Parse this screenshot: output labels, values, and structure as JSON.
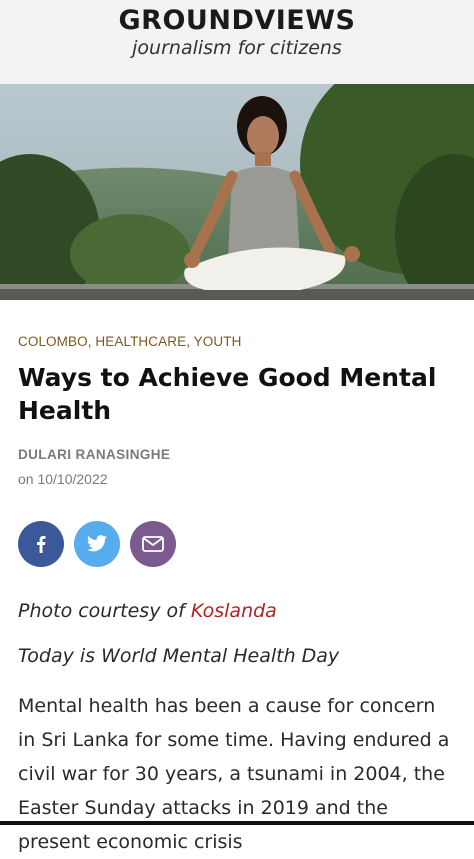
{
  "masthead": {
    "brand": "GROUNDVIEWS",
    "tagline": "journalism for citizens"
  },
  "hero": {
    "alt_icon": "meditation-photo"
  },
  "article": {
    "categories": [
      "COLOMBO",
      "HEALTHCARE",
      "YOUTH"
    ],
    "category_separator": ", ",
    "title": "Ways to Achieve Good Mental Health",
    "author": "DULARI RANASINGHE",
    "date": "on 10/10/2022",
    "credit_prefix": "Photo courtesy of ",
    "credit_link": "Koslanda",
    "intro": "Today is World Mental Health Day",
    "body": "Mental health has been a cause for concern in Sri Lanka for some time. Having endured a civil war for 30 years, a tsunami in 2004, the Easter Sunday attacks in 2019 and the present economic crisis"
  },
  "share": [
    {
      "name": "facebook",
      "icon": "facebook-icon",
      "color": "#3b5998"
    },
    {
      "name": "twitter",
      "icon": "twitter-icon",
      "color": "#55acee"
    },
    {
      "name": "email",
      "icon": "mail-icon",
      "color": "#7b5a8f"
    }
  ],
  "colors": {
    "category": "#7a5a20",
    "link": "#b22222",
    "meta": "#7a7a7a"
  }
}
